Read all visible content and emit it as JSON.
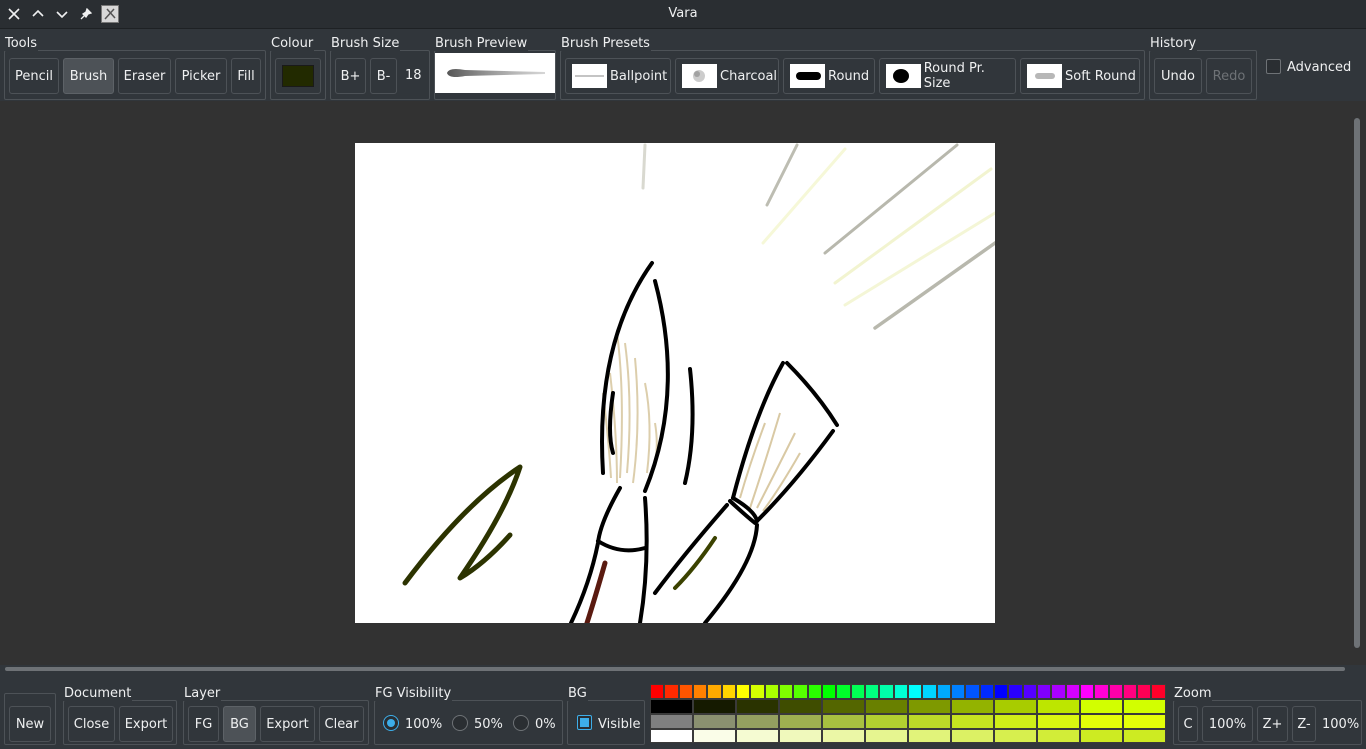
{
  "window": {
    "title": "Vara"
  },
  "titlebar_icons": [
    "close-icon",
    "chevron-up-icon",
    "chevron-down-icon",
    "pin-icon",
    "app-icon"
  ],
  "tools": {
    "label": "Tools",
    "items": [
      "Pencil",
      "Brush",
      "Eraser",
      "Picker",
      "Fill"
    ],
    "active": "Brush"
  },
  "colour": {
    "label": "Colour",
    "value": "#222a00"
  },
  "brush_size": {
    "label": "Brush Size",
    "plus": "B+",
    "minus": "B-",
    "value": "18"
  },
  "brush_preview": {
    "label": "Brush Preview"
  },
  "brush_presets": {
    "label": "Brush Presets",
    "items": [
      "Ballpoint",
      "Charcoal",
      "Round",
      "Round Pr. Size",
      "Soft Round"
    ]
  },
  "history": {
    "label": "History",
    "undo": "Undo",
    "redo": "Redo"
  },
  "advanced": {
    "label": "Advanced",
    "checked": false
  },
  "document": {
    "label": "Document",
    "new": "New",
    "close": "Close",
    "export": "Export"
  },
  "layer": {
    "label": "Layer",
    "fg": "FG",
    "bg": "BG",
    "export": "Export",
    "clear": "Clear",
    "active": "BG"
  },
  "fg_visibility": {
    "label": "FG Visibility",
    "options": [
      "100%",
      "50%",
      "0%"
    ],
    "selected": "100%"
  },
  "bg": {
    "label": "BG",
    "visible_label": "Visible",
    "checked": true
  },
  "zoom": {
    "label": "Zoom",
    "c": "C",
    "reset": "100%",
    "in": "Z+",
    "out": "Z-",
    "value": "100%"
  },
  "palette": {
    "hues": [
      "#ff0000",
      "#ff2a00",
      "#ff5500",
      "#ff8000",
      "#ffaa00",
      "#ffd500",
      "#ffff00",
      "#d5ff00",
      "#aaff00",
      "#80ff00",
      "#55ff00",
      "#2aff00",
      "#00ff00",
      "#00ff2a",
      "#00ff55",
      "#00ff80",
      "#00ffaa",
      "#00ffd5",
      "#00ffff",
      "#00d5ff",
      "#00aaff",
      "#0080ff",
      "#0055ff",
      "#002aff",
      "#0000ff",
      "#2a00ff",
      "#5500ff",
      "#8000ff",
      "#aa00ff",
      "#d500ff",
      "#ff00ff",
      "#ff00d5",
      "#ff00aa",
      "#ff0080",
      "#ff0055",
      "#ff002a"
    ],
    "shades_dark": [
      "#000000",
      "#151a00",
      "#2a3300",
      "#3f4d00",
      "#546600",
      "#698000",
      "#7e9900",
      "#93b300",
      "#a8cc00",
      "#bde600",
      "#d2ff00",
      "#d2ff00"
    ],
    "shades_mid": [
      "#808080",
      "#8a9070",
      "#94a060",
      "#9eb050",
      "#a8c040",
      "#b2d030",
      "#bcda28",
      "#c6e420",
      "#d0ee18",
      "#daf810",
      "#e4ff08",
      "#e4ff08"
    ],
    "shades_light": [
      "#ffffff",
      "#fafde8",
      "#f5fbd2",
      "#f0f9bc",
      "#ebf7a6",
      "#e6f590",
      "#e1f37a",
      "#dcf164",
      "#d7ef4e",
      "#d2ed38",
      "#cdeb22",
      "#cdeb22"
    ]
  }
}
